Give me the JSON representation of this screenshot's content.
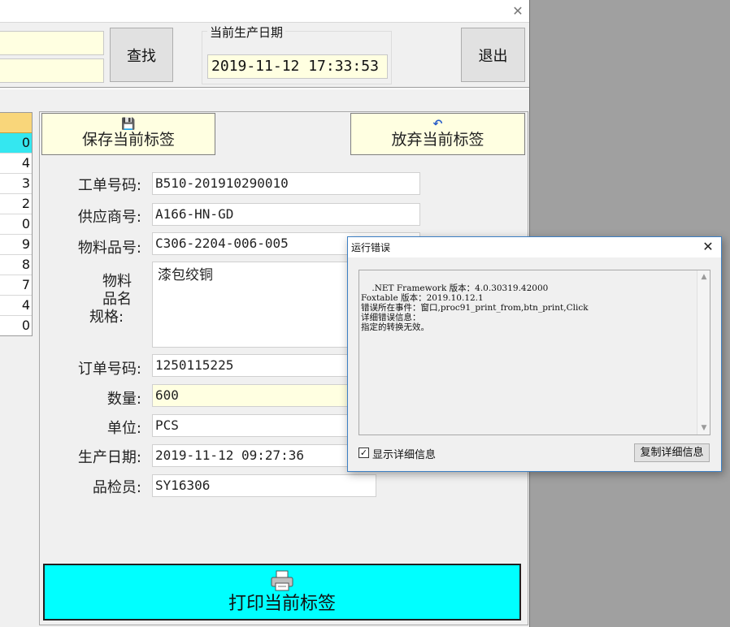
{
  "toolbar": {
    "search_label": "查找",
    "exit_label": "退出",
    "date_group_label": "当前生产日期",
    "current_datetime": "2019-11-12 17:33:53"
  },
  "list": {
    "rows": [
      "0",
      "4",
      "3",
      "2",
      "0",
      "9",
      "8",
      "7",
      "4",
      "0"
    ]
  },
  "actions": {
    "save_label": "保存当前标签",
    "discard_label": "放弃当前标签",
    "print_label": "打印当前标签"
  },
  "form": {
    "work_order_label": "工单号码:",
    "work_order": "B510-201910290010",
    "supplier_label": "供应商号:",
    "supplier": "A166-HN-GD",
    "material_no_label": "物料品号:",
    "material_no": "C306-2204-006-005",
    "material_spec_label_1": "物料",
    "material_spec_label_2": "品名",
    "material_spec_label_3": "规格:",
    "material_spec": "漆包绞铜",
    "order_no_label": "订单号码:",
    "order_no": "1250115225",
    "quantity_label": "数量:",
    "quantity": "600",
    "unit_label": "单位:",
    "unit": "PCS",
    "production_date_label": "生产日期:",
    "production_date": "2019-11-12 09:27:36",
    "inspector_label": "品检员:",
    "inspector": "SY16306"
  },
  "error_dialog": {
    "title": "运行错误",
    "message": ".NET Framework 版本：4.0.30319.42000\nFoxtable 版本：2019.10.12.1\n错误所在事件：窗口,proc91_print_from,btn_print,Click\n详细错误信息：\n指定的转换无效。",
    "show_details_label": "显示详细信息",
    "show_details_checked": true,
    "copy_button_label": "复制详细信息"
  },
  "colors": {
    "input_yellow": "#ffffe1",
    "list_header": "#f9d67a",
    "list_selected": "#34e7f0",
    "print_button": "#00ffff"
  },
  "icons": [
    "close-icon",
    "save-disk-icon",
    "undo-icon",
    "printer-icon"
  ]
}
